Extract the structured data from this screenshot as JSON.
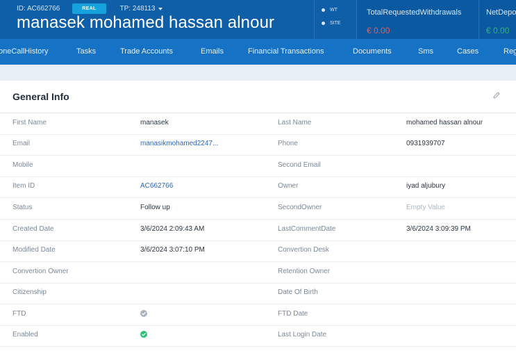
{
  "header": {
    "id_label": "ID: AC662766",
    "badge": "REAL",
    "tp_label": "TP: 248113",
    "name": "manasek mohamed hassan alnour",
    "toggles": [
      "WT",
      "SITE"
    ],
    "stats": [
      {
        "label": "TotalRequestedWithdrawals",
        "value": "€ 0.00",
        "color": "#e45a5a"
      },
      {
        "label": "NetDepo",
        "value": "€ 0.00",
        "color": "#2bb673"
      }
    ]
  },
  "nav": {
    "items": [
      "oneCallHistory",
      "Tasks",
      "Trade Accounts",
      "Emails",
      "Financial Transactions",
      "Documents",
      "Sms",
      "Cases",
      "Reg"
    ]
  },
  "card": {
    "title": "General Info",
    "rows": [
      {
        "l1": "First Name",
        "v1": "manasek",
        "l2": "Last Name",
        "v2": "mohamed hassan alnour"
      },
      {
        "l1": "Email",
        "v1": "manasikmohamed2247...",
        "l2": "Phone",
        "v2": "0931939707"
      },
      {
        "l1": "Mobile",
        "v1": "",
        "l2": "Second Email",
        "v2": ""
      },
      {
        "l1": "Item ID",
        "v1": "AC662766",
        "l2": "Owner",
        "v2": "iyad aljubury"
      },
      {
        "l1": "Status",
        "v1": "Follow up",
        "l2": "SecondOwner",
        "v2": "Empty Value"
      },
      {
        "l1": "Created Date",
        "v1": "3/6/2024 2:09:43 AM",
        "l2": "LastCommentDate",
        "v2": "3/6/2024 3:09:39 PM"
      },
      {
        "l1": "Modified Date",
        "v1": "3/6/2024 3:07:10 PM",
        "l2": "Convertion Desk",
        "v2": ""
      },
      {
        "l1": "Convertion Owner",
        "v1": "",
        "l2": "Retention Owner",
        "v2": ""
      },
      {
        "l1": "Citizenship",
        "v1": "",
        "l2": "Date Of Birth",
        "v2": ""
      },
      {
        "l1": "FTD",
        "v1": "",
        "l2": "FTD Date",
        "v2": ""
      },
      {
        "l1": "Enabled",
        "v1": "",
        "l2": "Last Login Date",
        "v2": ""
      }
    ],
    "checks": {
      "ftd": true,
      "enabled": true
    },
    "icons": {
      "edit": "pencil-icon",
      "ftd": "check-circle-icon",
      "enabled": "check-circle-icon"
    }
  }
}
